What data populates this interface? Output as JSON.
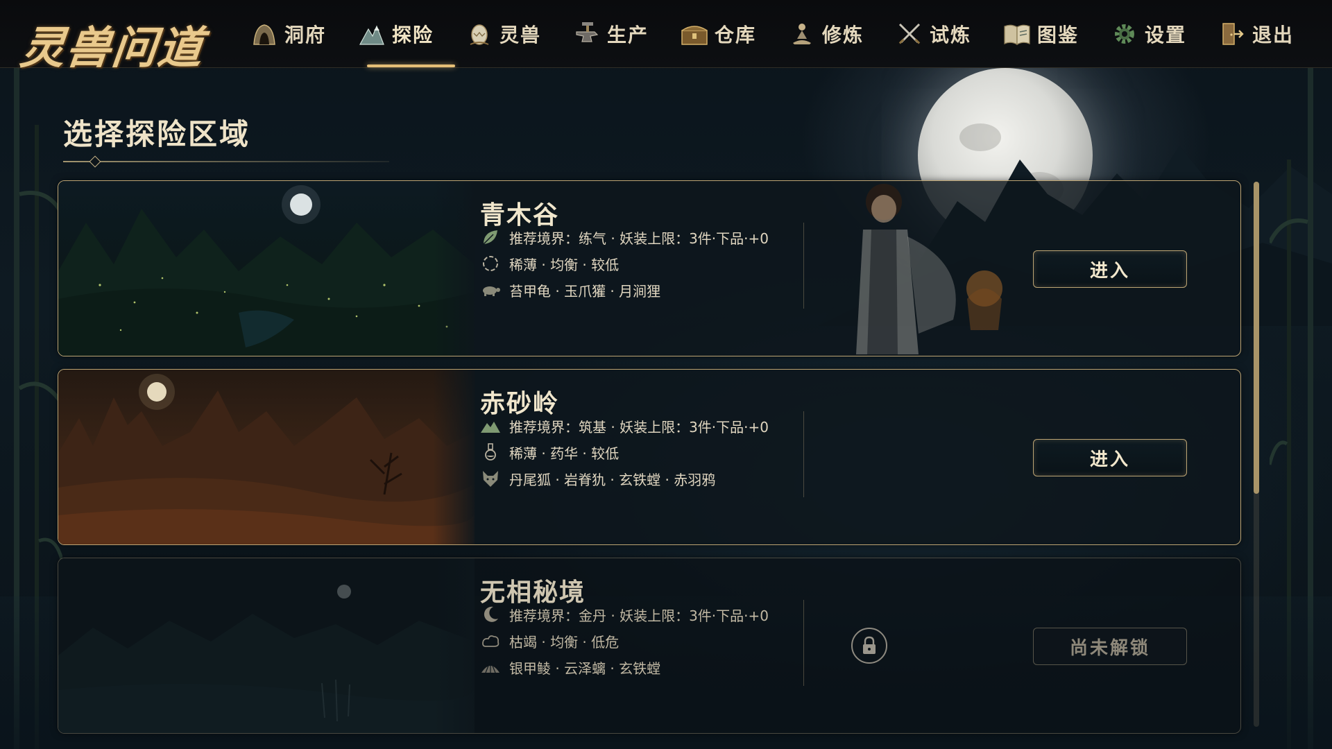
{
  "game": {
    "logo_text": "灵兽问道"
  },
  "nav": {
    "items": [
      {
        "label": "洞府",
        "icon": "cave-icon",
        "active": false
      },
      {
        "label": "探险",
        "icon": "mountain-icon",
        "active": true
      },
      {
        "label": "灵兽",
        "icon": "egg-icon",
        "active": false
      },
      {
        "label": "生产",
        "icon": "anvil-icon",
        "active": false
      },
      {
        "label": "仓库",
        "icon": "chest-icon",
        "active": false
      },
      {
        "label": "修炼",
        "icon": "meditation-icon",
        "active": false
      },
      {
        "label": "试炼",
        "icon": "crossed-swords-icon",
        "active": false
      },
      {
        "label": "图鉴",
        "icon": "book-icon",
        "active": false
      },
      {
        "label": "设置",
        "icon": "gear-icon",
        "active": false
      },
      {
        "label": "退出",
        "icon": "exit-door-icon",
        "active": false
      }
    ]
  },
  "section": {
    "title": "选择探险区域"
  },
  "areas": [
    {
      "name": "青木谷",
      "realm_line": "推荐境界：练气 · 妖装上限：3件·下品·+0",
      "env_line": "稀薄 · 均衡 · 较低",
      "beasts_line": "苔甲龟 · 玉爪獾 · 月涧狸",
      "icons": [
        "leaf-icon",
        "cycle-icon",
        "turtle-icon"
      ],
      "button_label": "进入",
      "locked": false
    },
    {
      "name": "赤砂岭",
      "realm_line": "推荐境界：筑基 · 妖装上限：3件·下品·+0",
      "env_line": "稀薄 · 药华 · 较低",
      "beasts_line": "丹尾狐 · 岩脊犰 · 玄铁螳 · 赤羽鸦",
      "icons": [
        "mountain-range-icon",
        "potion-flask-icon",
        "fox-icon"
      ],
      "button_label": "进入",
      "locked": false
    },
    {
      "name": "无相秘境",
      "realm_line": "推荐境界：金丹 · 妖装上限：3件·下品·+0",
      "env_line": "枯竭 · 均衡 · 低危",
      "beasts_line": "银甲鲮 · 云泽螭 · 玄铁螳",
      "icons": [
        "crescent-moon-icon",
        "cloud-swirl-icon",
        "scale-shell-icon"
      ],
      "button_label": "尚未解锁",
      "locked": true
    }
  ],
  "colors": {
    "gold_border": "#bda574",
    "accent": "#e6bf77",
    "text_light": "#f0e6cc"
  }
}
